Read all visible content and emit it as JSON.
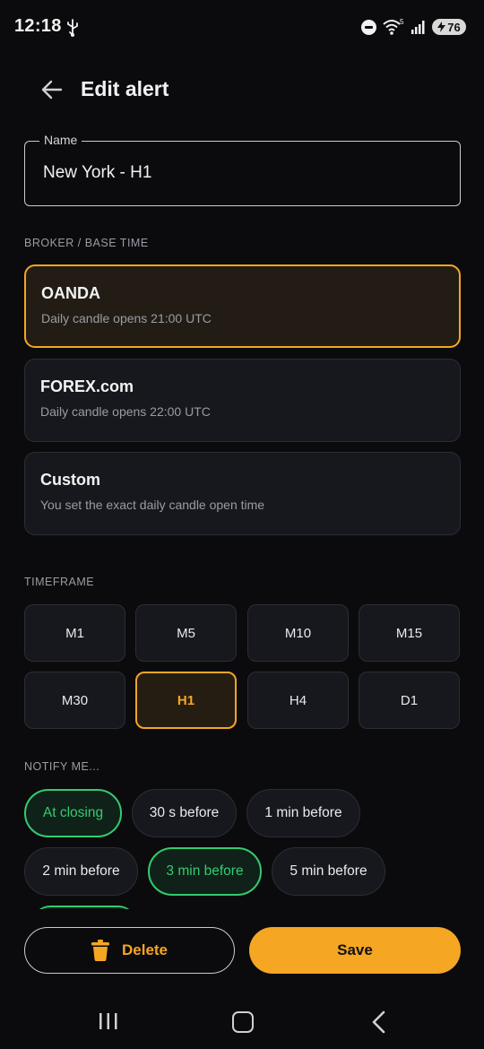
{
  "status_bar": {
    "time": "12:18",
    "battery": "76",
    "icons": [
      "usb-icon",
      "do-not-disturb-icon",
      "wifi-icon",
      "signal-icon",
      "battery-charging-icon"
    ],
    "wifi_label": "5"
  },
  "header": {
    "title": "Edit alert",
    "back_icon": "arrow-left-icon"
  },
  "name_field": {
    "label": "Name",
    "value": "New York - H1"
  },
  "broker_section": {
    "label": "BROKER / BASE TIME",
    "options": [
      {
        "name": "OANDA",
        "desc": "Daily candle opens 21:00 UTC",
        "selected": true
      },
      {
        "name": "FOREX.com",
        "desc": "Daily candle opens 22:00 UTC",
        "selected": false
      },
      {
        "name": "Custom",
        "desc": "You set the exact daily candle open time",
        "selected": false
      }
    ]
  },
  "timeframe_section": {
    "label": "TIMEFRAME",
    "options": [
      "M1",
      "M5",
      "M10",
      "M15",
      "M30",
      "H1",
      "H4",
      "D1"
    ],
    "selected": "H1"
  },
  "notify_section": {
    "label": "NOTIFY ME...",
    "options": [
      "At closing",
      "30 s before",
      "1 min before",
      "2 min before",
      "3 min before",
      "5 min before"
    ],
    "selected": [
      "At closing",
      "3 min before"
    ]
  },
  "actions": {
    "delete_label": "Delete",
    "save_label": "Save"
  },
  "colors": {
    "accent": "#f5a623",
    "success": "#33cc6f",
    "background": "#0b0b0d",
    "card": "#16181d"
  }
}
